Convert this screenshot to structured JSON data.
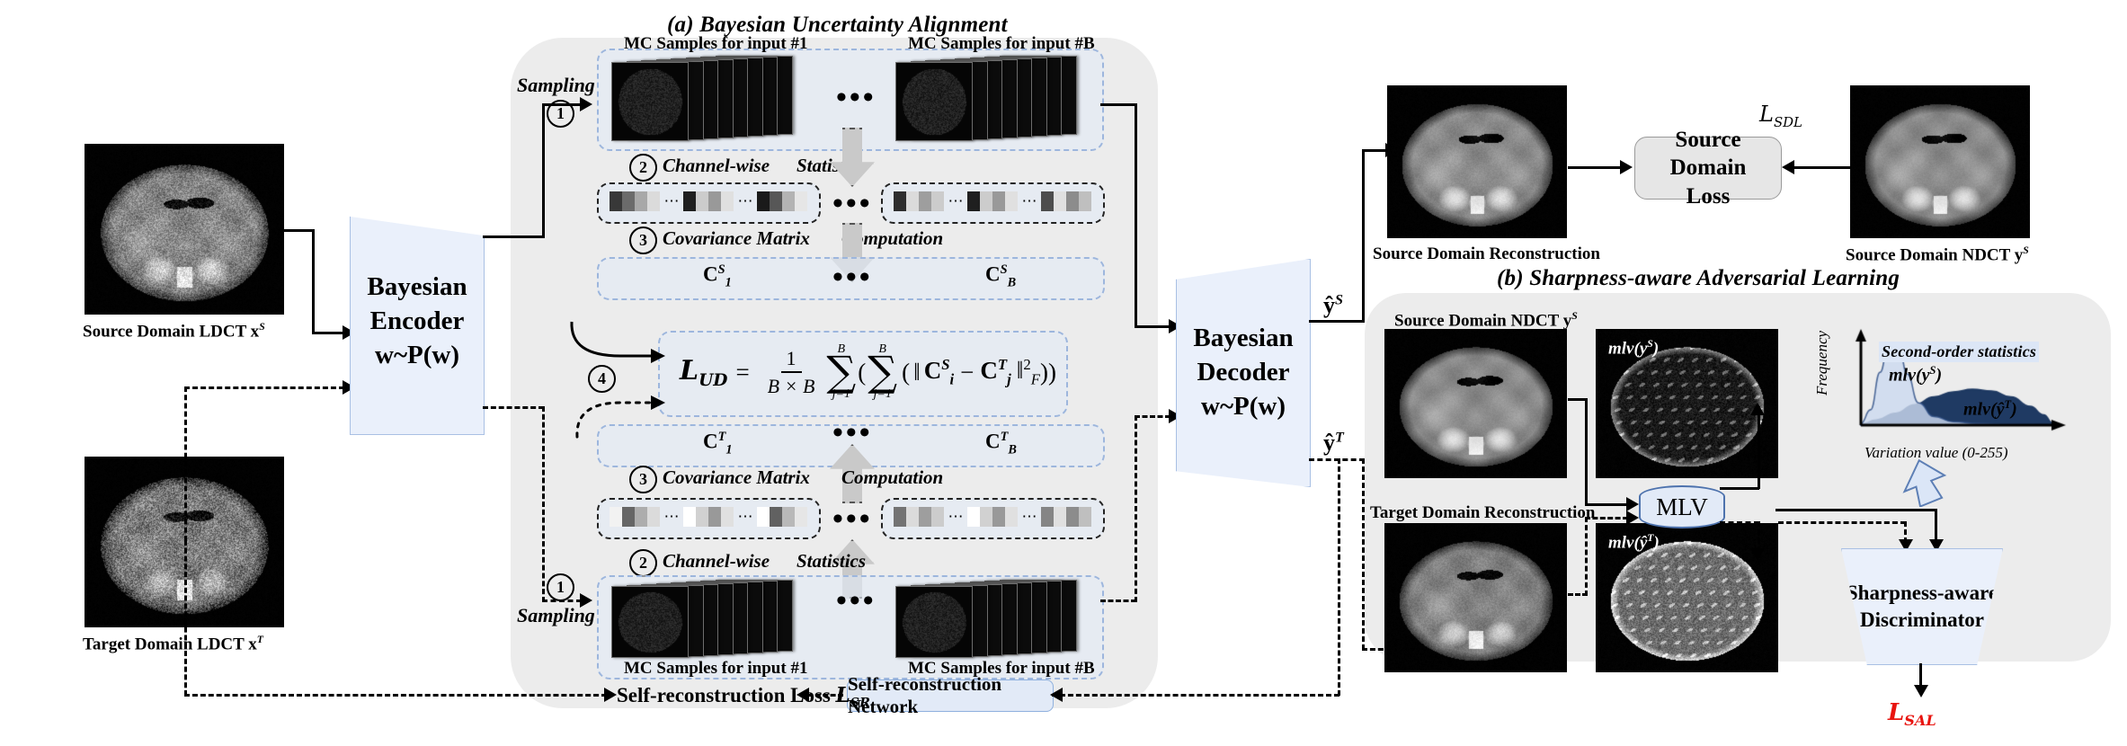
{
  "sections": {
    "a_title": "(a) Bayesian Uncertainty Alignment",
    "b_title": "(b) Sharpness-aware Adversarial Learning"
  },
  "inputs": {
    "source_label": "Source Domain  LDCT x",
    "source_sup": "S",
    "target_label": "Target Domain LDCT x",
    "target_sup": "T"
  },
  "encoder": {
    "line1": "Bayesian",
    "line2": "Encoder",
    "line3": "w~P(w)"
  },
  "decoder": {
    "line1": "Bayesian",
    "line2": "Decoder",
    "line3": "w~P(w)"
  },
  "discriminator": {
    "line1": "Sharpness-aware",
    "line2": "Discriminator"
  },
  "steps": {
    "s1": "1",
    "s2": "2",
    "s3": "3",
    "s4": "4"
  },
  "bua": {
    "sampling": "Sampling",
    "mc_first": "MC Samples for input #1",
    "mc_last": "MC Samples for input #B",
    "channel_wise": "Channel-wise",
    "statistics": "Statistics",
    "cov_matrix": "Covariance Matrix",
    "computation": "Computation",
    "cov_s_first": "C",
    "cov_s_first_sub": "1",
    "cov_s_first_sup": "S",
    "cov_s_last": "C",
    "cov_s_last_sub": "B",
    "cov_s_last_sup": "S",
    "cov_t_first": "C",
    "cov_t_first_sub": "1",
    "cov_t_first_sup": "T",
    "cov_t_last": "C",
    "cov_t_last_sub": "B",
    "cov_t_last_sup": "T",
    "dots": "•••"
  },
  "formula": {
    "loss_name": "L",
    "loss_sub": "UD",
    "equals": "=",
    "frac_num": "1",
    "frac_den": "B × B",
    "sum1_top": "B",
    "sum1_bot": "j=1",
    "sum2_top": "B",
    "sum2_bot": "j=1",
    "open1": "(",
    "open2": "(",
    "norm_open": "‖",
    "ci": "C",
    "ci_sub": "i",
    "ci_sup": "S",
    "minus": "−",
    "cj": "C",
    "cj_sub": "j",
    "cj_sup": "T",
    "norm_close": "‖",
    "norm_sub": "F",
    "norm_sup": "2",
    "close": "))",
    "color": "#e8140f"
  },
  "outputs": {
    "yhat_s": "ŷ",
    "yhat_s_sup": "S",
    "yhat_t": "ŷ",
    "yhat_t_sup": "T"
  },
  "sdl": {
    "recon_label": "Source Domain Reconstruction",
    "ndct_label": "Source Domain NDCT y",
    "ndct_sup": "S",
    "loss_box_l1": "Source Domain",
    "loss_box_l2": "Loss",
    "loss_symbol": "L",
    "loss_symbol_sub": "SDL"
  },
  "sal": {
    "src_ndct": "Source Domain NDCT y",
    "src_ndct_sup": "S",
    "tgt_recon": "Target Domain Reconstruction",
    "mlv_s": "mlv(y",
    "mlv_s_sup": "S",
    "mlv_s_close": ")",
    "mlv_t": "mlv(ŷ",
    "mlv_t_sup": "T",
    "mlv_t_close": ")",
    "mlv_node": "MLV",
    "loss_symbol": "L",
    "loss_symbol_sub": "SAL",
    "loss_color": "#e8140f"
  },
  "selfrecon": {
    "loss_text": "Self-reconstruction Loss",
    "loss_symbol": "L",
    "loss_symbol_sub": "SR",
    "network": "Self-reconstruction Network"
  },
  "chart_data": {
    "type": "area",
    "title": "Second-order statistics",
    "xlabel": "Variation value (0-255)",
    "ylabel": "Frequency",
    "grid": false,
    "legend_position": "inline-annotation",
    "series": [
      {
        "name": "mlv(y^S)",
        "label": "mlv(y",
        "label_sup": "S",
        "label_close": ")",
        "color": "#ccd9ef",
        "stroke": "#2f4f86",
        "peak_x": 0.17,
        "peak_y": 0.95,
        "spread": 0.09,
        "x": [
          0.0,
          0.05,
          0.1,
          0.14,
          0.17,
          0.2,
          0.24,
          0.3,
          0.38,
          0.48,
          0.6,
          0.75,
          1.0
        ],
        "y": [
          0.02,
          0.18,
          0.62,
          0.9,
          0.95,
          0.88,
          0.6,
          0.26,
          0.1,
          0.04,
          0.02,
          0.01,
          0.0
        ]
      },
      {
        "name": "mlv(yhat^T)",
        "label": "mlv(ŷ",
        "label_sup": "T",
        "label_close": ")",
        "color": "#1f3a63",
        "stroke": "#1f3a63",
        "peak_x": 0.58,
        "peak_y": 0.42,
        "spread": 0.3,
        "x": [
          0.0,
          0.08,
          0.18,
          0.28,
          0.38,
          0.48,
          0.58,
          0.68,
          0.78,
          0.88,
          0.95,
          1.0
        ],
        "y": [
          0.01,
          0.06,
          0.14,
          0.24,
          0.33,
          0.39,
          0.42,
          0.4,
          0.33,
          0.22,
          0.12,
          0.02
        ]
      }
    ],
    "xlim": [
      0,
      255
    ],
    "ylim": [
      0,
      1
    ]
  },
  "strip_values": {
    "row_s": [
      [
        0.22,
        0.42,
        0.66,
        0.86
      ],
      [
        0.12,
        0.8,
        0.6,
        0.88
      ],
      [
        0.1,
        0.34,
        0.7,
        0.9
      ],
      [
        0.18,
        0.86,
        0.62,
        0.8
      ],
      [
        0.3,
        0.88,
        0.55,
        0.75
      ]
    ],
    "row_t": [
      [
        0.95,
        0.4,
        0.68,
        0.86
      ],
      [
        1.0,
        0.82,
        0.6,
        0.88
      ],
      [
        1.0,
        0.38,
        0.72,
        0.9
      ],
      [
        0.45,
        0.86,
        0.62,
        0.8
      ],
      [
        0.52,
        0.88,
        0.55,
        0.75
      ]
    ]
  }
}
